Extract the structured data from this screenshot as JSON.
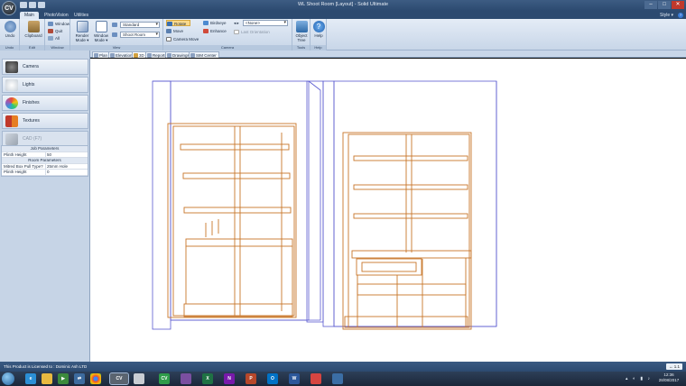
{
  "window": {
    "title": "WL Shoot Room [Layout] - Solid Ultimate",
    "logo": "CV"
  },
  "tabs": [
    "Main",
    "PhotoVision",
    "Utilities"
  ],
  "style_menu": "Style ▾",
  "ribbon": {
    "groups": [
      "Undo",
      "Edit",
      "Window",
      "View",
      "Camera",
      "Tools",
      "Help"
    ],
    "undo_label": "Undo",
    "clipboard_label": "Clipboard",
    "window_label": "Window",
    "quit_label": "Quit",
    "all_label": "All",
    "render_mode": "Render Mode ▾",
    "window_mode": "Window Mode ▾",
    "view_combo_1": "Standard",
    "view_combo_2": "Shoot Room",
    "rotate_label": "Rotate",
    "move_label": "Move",
    "camera_move_label": "Camera Move",
    "birdseye_label": "Birdseye",
    "enhance_label": "Enhance",
    "camera_combo": "<None>",
    "last_orientation": "Last Orientation",
    "object_tree_label": "Object Tree",
    "help_label": "Help"
  },
  "doc_tabs": [
    "Plan",
    "Elevation",
    "3D",
    "Reports",
    "Drawings",
    "SIM Center"
  ],
  "sidebar": {
    "items": [
      "Camera",
      "Lights",
      "Finishes",
      "Textures",
      "CAD (F7)"
    ],
    "properties": {
      "job_header": "Job Parameters",
      "job_rows": [
        {
          "key": "Plinth Height",
          "value": "50"
        }
      ],
      "room_header": "Room Parameters",
      "room_rows": [
        {
          "key": "Mitred Box Pull Type?",
          "value": "25mm Hole"
        },
        {
          "key": "Plinth Height",
          "value": "0"
        }
      ]
    }
  },
  "status": {
    "licence": "This Product is Licensed to : Dominic Ash LTD",
    "zoom": "↔  1.1"
  },
  "taskbar": {
    "time": "12:36",
    "date": "28/08/2017"
  },
  "colors": {
    "cabinet_line": "#c8762a",
    "wall_line": "#5a5ad0",
    "ribbon_bg": "#dbe5f1",
    "titlebar": "#2c4a70"
  }
}
